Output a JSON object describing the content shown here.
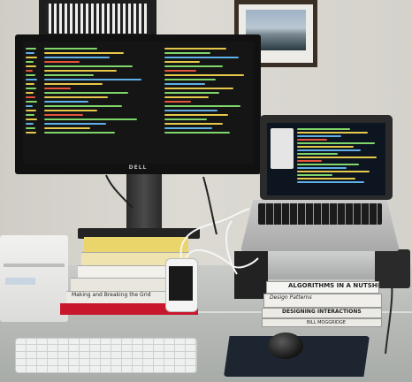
{
  "scene": {
    "monitor_brand": "DELL",
    "books_left": [
      {
        "title": "",
        "color": "#e9d56a"
      },
      {
        "title": "",
        "color": "#efe3b0"
      },
      {
        "title": "",
        "color": "#f1f0ea"
      },
      {
        "title": "",
        "color": "#e8e6dd"
      },
      {
        "title": "Making and Breaking the Grid",
        "color": "#ecebe5"
      },
      {
        "title": "",
        "color": "#c8172c"
      }
    ],
    "books_right": [
      {
        "title": "ALGORITHMS IN A NUTSHELL",
        "color": "#f5f5f2"
      },
      {
        "title": "Design Patterns",
        "color": "#f0efe9"
      },
      {
        "title": "DESIGNING INTERACTIONS",
        "color": "#ebeae4"
      },
      {
        "title": "BILL MOGGRIDGE",
        "color": "#ebeae4"
      }
    ],
    "colors": {
      "wall": "#d6d4cd",
      "desk": "#b9bcb8",
      "code_green": "#7fd66b",
      "code_yellow": "#e6c84a",
      "code_blue": "#5fb0e6",
      "code_red": "#e4553c"
    }
  }
}
